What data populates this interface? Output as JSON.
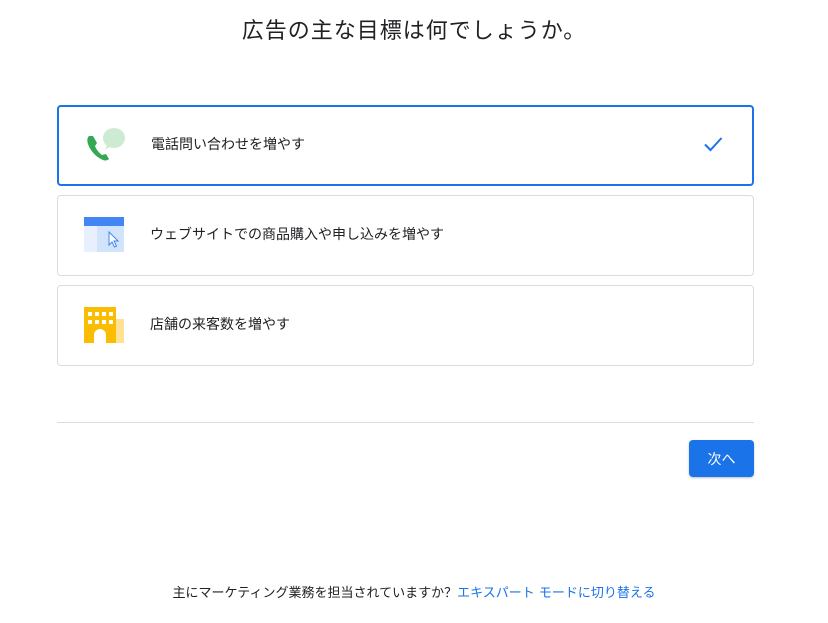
{
  "page": {
    "title": "広告の主な目標は何でしょうか。"
  },
  "options": [
    {
      "label": "電話問い合わせを増やす",
      "icon": "phone-chat-icon",
      "selected": true
    },
    {
      "label": "ウェブサイトでの商品購入や申し込みを増やす",
      "icon": "browser-cursor-icon",
      "selected": false
    },
    {
      "label": "店舗の来客数を増やす",
      "icon": "store-building-icon",
      "selected": false
    }
  ],
  "actions": {
    "next_label": "次へ"
  },
  "footer": {
    "question": "主にマーケティング業務を担当されていますか？",
    "expert_link": "エキスパート モードに切り替える"
  },
  "colors": {
    "accent": "#1a73e8",
    "border": "#dadce0",
    "phone_green": "#34a853",
    "bubble_green": "#cdebd3",
    "store_yellow": "#fbbc04"
  }
}
